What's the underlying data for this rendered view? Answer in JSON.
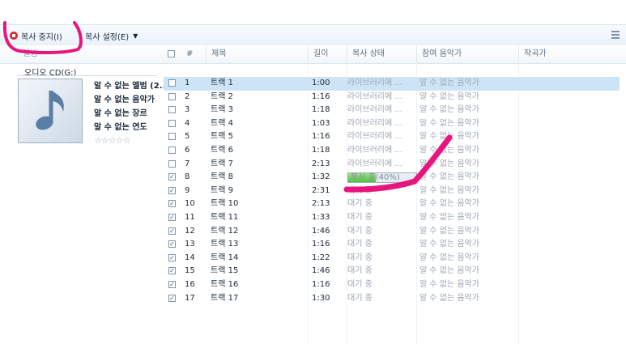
{
  "toolbar": {
    "stop_label": "복사 중지(I)",
    "settings_label": "복사 설정(E)"
  },
  "columns": {
    "album": "앨범",
    "num": "#",
    "title": "제목",
    "length": "길이",
    "status": "복사 상태",
    "artist": "참여 음악가",
    "composer": "작곡가"
  },
  "album": {
    "source": "오디오 CD(G:)",
    "name": "알 수 없는 앨범 (2...",
    "artist": "알 수 없는 음악가",
    "genre": "알 수 없는 장르",
    "year": "알 수 없는 연도",
    "rating": 0
  },
  "tracks": [
    {
      "num": "1",
      "title": "트랙 1",
      "length": "1:00",
      "status": "라이브러리에 ...",
      "artist": "알 수 없는 음악가",
      "checked": false
    },
    {
      "num": "2",
      "title": "트랙 2",
      "length": "1:16",
      "status": "라이브러리에 ...",
      "artist": "알 수 없는 음악가",
      "checked": false
    },
    {
      "num": "3",
      "title": "트랙 3",
      "length": "1:18",
      "status": "라이브러리에 ...",
      "artist": "알 수 없는 음악가",
      "checked": false
    },
    {
      "num": "4",
      "title": "트랙 4",
      "length": "1:03",
      "status": "라이브러리에 ...",
      "artist": "알 수 없는 음악가",
      "checked": false
    },
    {
      "num": "5",
      "title": "트랙 5",
      "length": "1:16",
      "status": "라이브러리에 ...",
      "artist": "알 수 없는 음악가",
      "checked": false
    },
    {
      "num": "6",
      "title": "트랙 6",
      "length": "1:18",
      "status": "라이브러리에 ...",
      "artist": "알 수 없는 음악가",
      "checked": false
    },
    {
      "num": "7",
      "title": "트랙 7",
      "length": "2:13",
      "status": "라이브러리에 ...",
      "artist": "알 수 없는 음악가",
      "checked": false
    },
    {
      "num": "8",
      "title": "트랙 8",
      "length": "1:32",
      "status": "복사 중(40%)",
      "artist": "알 수 없는 음악가",
      "checked": true,
      "progress": 0.4
    },
    {
      "num": "9",
      "title": "트랙 9",
      "length": "2:31",
      "status": "대기 중",
      "artist": "알 수 없는 음악가",
      "checked": true
    },
    {
      "num": "10",
      "title": "트랙 10",
      "length": "2:13",
      "status": "대기 중",
      "artist": "알 수 없는 음악가",
      "checked": true
    },
    {
      "num": "11",
      "title": "트랙 11",
      "length": "1:33",
      "status": "대기 중",
      "artist": "알 수 없는 음악가",
      "checked": true
    },
    {
      "num": "12",
      "title": "트랙 12",
      "length": "1:46",
      "status": "대기 중",
      "artist": "알 수 없는 음악가",
      "checked": true
    },
    {
      "num": "13",
      "title": "트랙 13",
      "length": "1:16",
      "status": "대기 중",
      "artist": "알 수 없는 음악가",
      "checked": true
    },
    {
      "num": "14",
      "title": "트랙 14",
      "length": "1:22",
      "status": "대기 중",
      "artist": "알 수 없는 음악가",
      "checked": true
    },
    {
      "num": "15",
      "title": "트랙 15",
      "length": "1:46",
      "status": "대기 중",
      "artist": "알 수 없는 음악가",
      "checked": true
    },
    {
      "num": "16",
      "title": "트랙 16",
      "length": "1:16",
      "status": "대기 중",
      "artist": "알 수 없는 음악가",
      "checked": true
    },
    {
      "num": "17",
      "title": "트랙 17",
      "length": "1:30",
      "status": "대기 중",
      "artist": "알 수 없는 음악가",
      "checked": true
    }
  ],
  "colors": {
    "selection": "#cde4f7",
    "progress": "#4fc23a",
    "stop": "#d9272e",
    "annotation": "#e8157f"
  }
}
